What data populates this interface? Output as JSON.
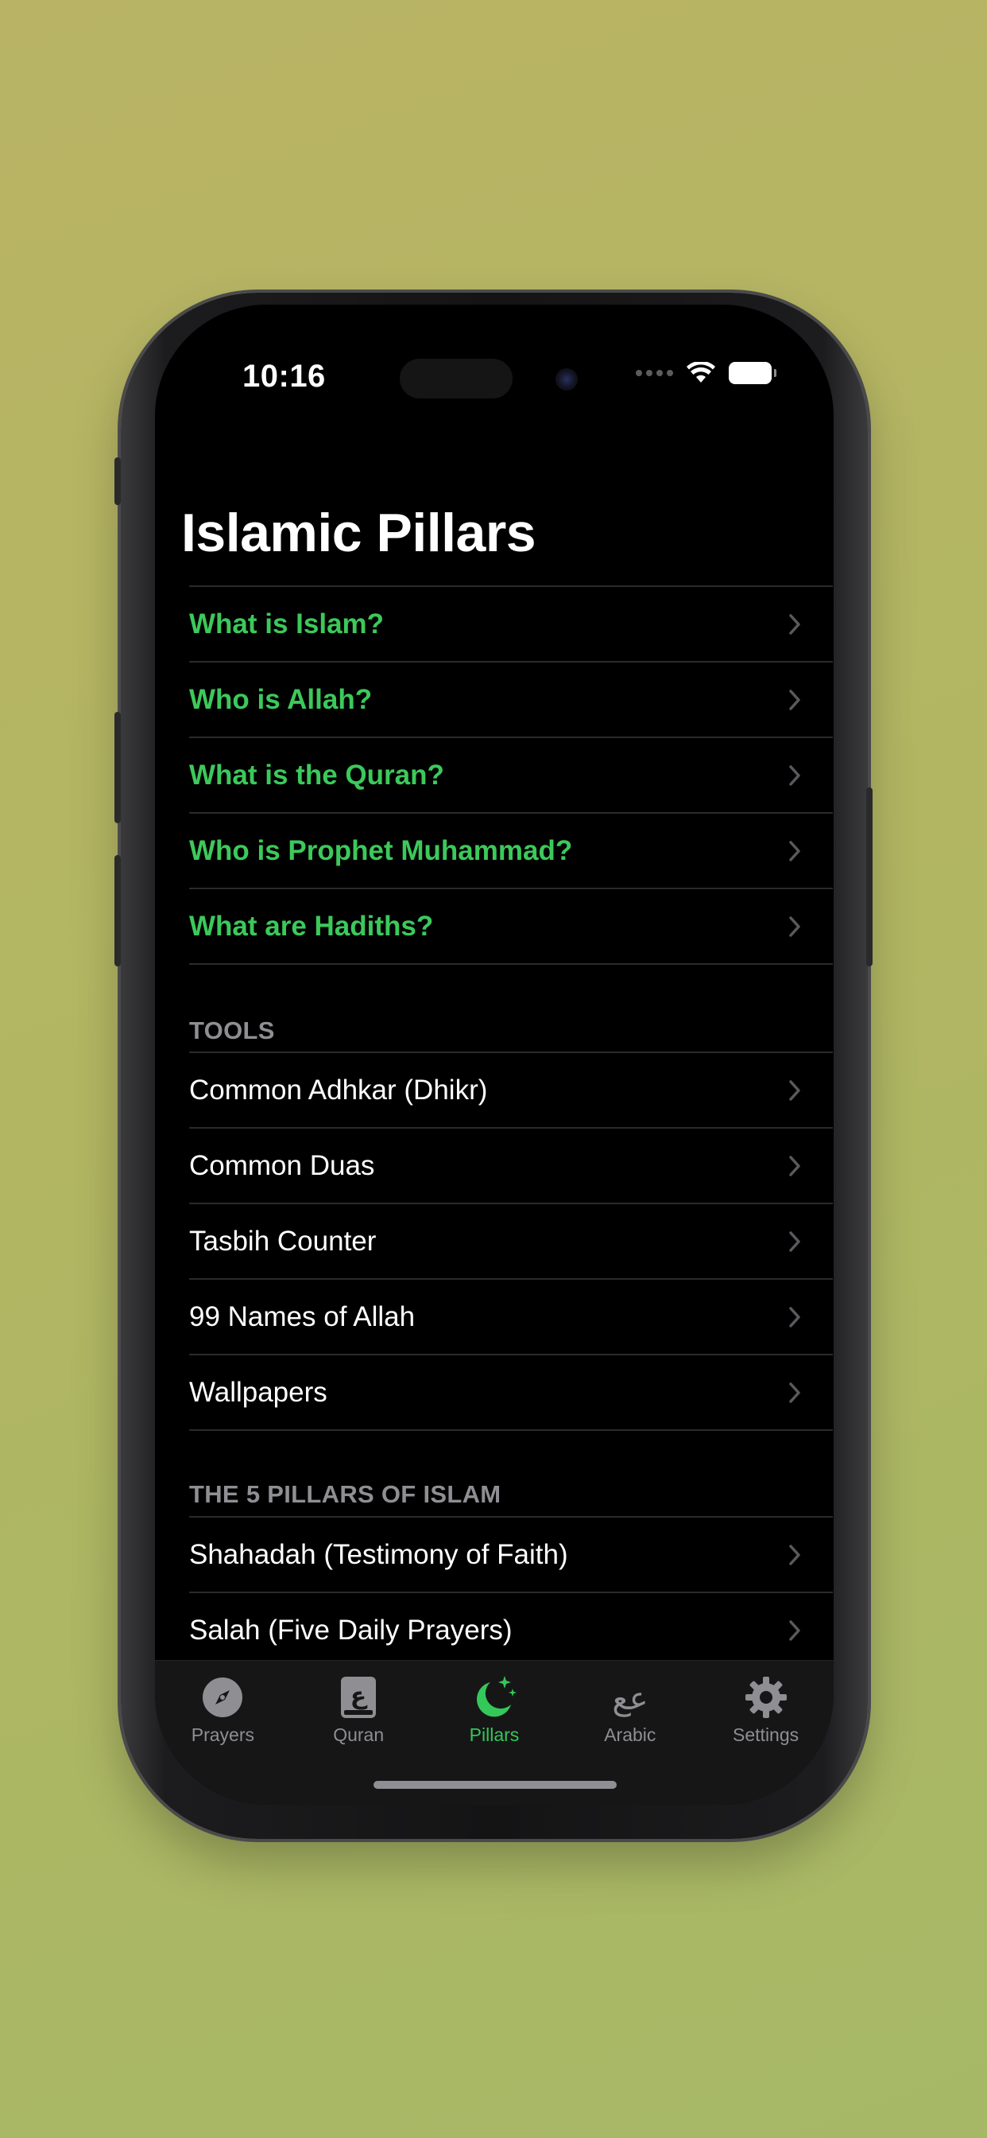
{
  "status_bar": {
    "time": "10:16"
  },
  "page": {
    "title": "Islamic Pillars"
  },
  "intro_items": [
    {
      "label": "What is Islam?"
    },
    {
      "label": "Who is Allah?"
    },
    {
      "label": "What is the Quran?"
    },
    {
      "label": "Who is Prophet Muhammad?"
    },
    {
      "label": "What are Hadiths?"
    }
  ],
  "tools_section": {
    "header": "TOOLS",
    "items": [
      {
        "label": "Common Adhkar (Dhikr)"
      },
      {
        "label": "Common Duas"
      },
      {
        "label": "Tasbih Counter"
      },
      {
        "label": "99 Names of Allah"
      },
      {
        "label": "Wallpapers"
      }
    ]
  },
  "pillars_section": {
    "header": "THE 5 PILLARS OF ISLAM",
    "items": [
      {
        "label": "Shahadah (Testimony of Faith)"
      },
      {
        "label": "Salah (Five Daily Prayers)"
      }
    ]
  },
  "tab_bar": {
    "tabs": [
      {
        "label": "Prayers",
        "icon": "compass-icon",
        "active": false
      },
      {
        "label": "Quran",
        "icon": "book-icon",
        "active": false
      },
      {
        "label": "Pillars",
        "icon": "moon-stars-icon",
        "active": true
      },
      {
        "label": "Arabic",
        "icon": "arabic-letters-icon",
        "active": false
      },
      {
        "label": "Settings",
        "icon": "gear-icon",
        "active": false
      }
    ]
  },
  "colors": {
    "accent_green": "#34c759",
    "intro_link_green": "#3cc95a",
    "background": "#000000",
    "secondary_text": "#8e8e93"
  }
}
